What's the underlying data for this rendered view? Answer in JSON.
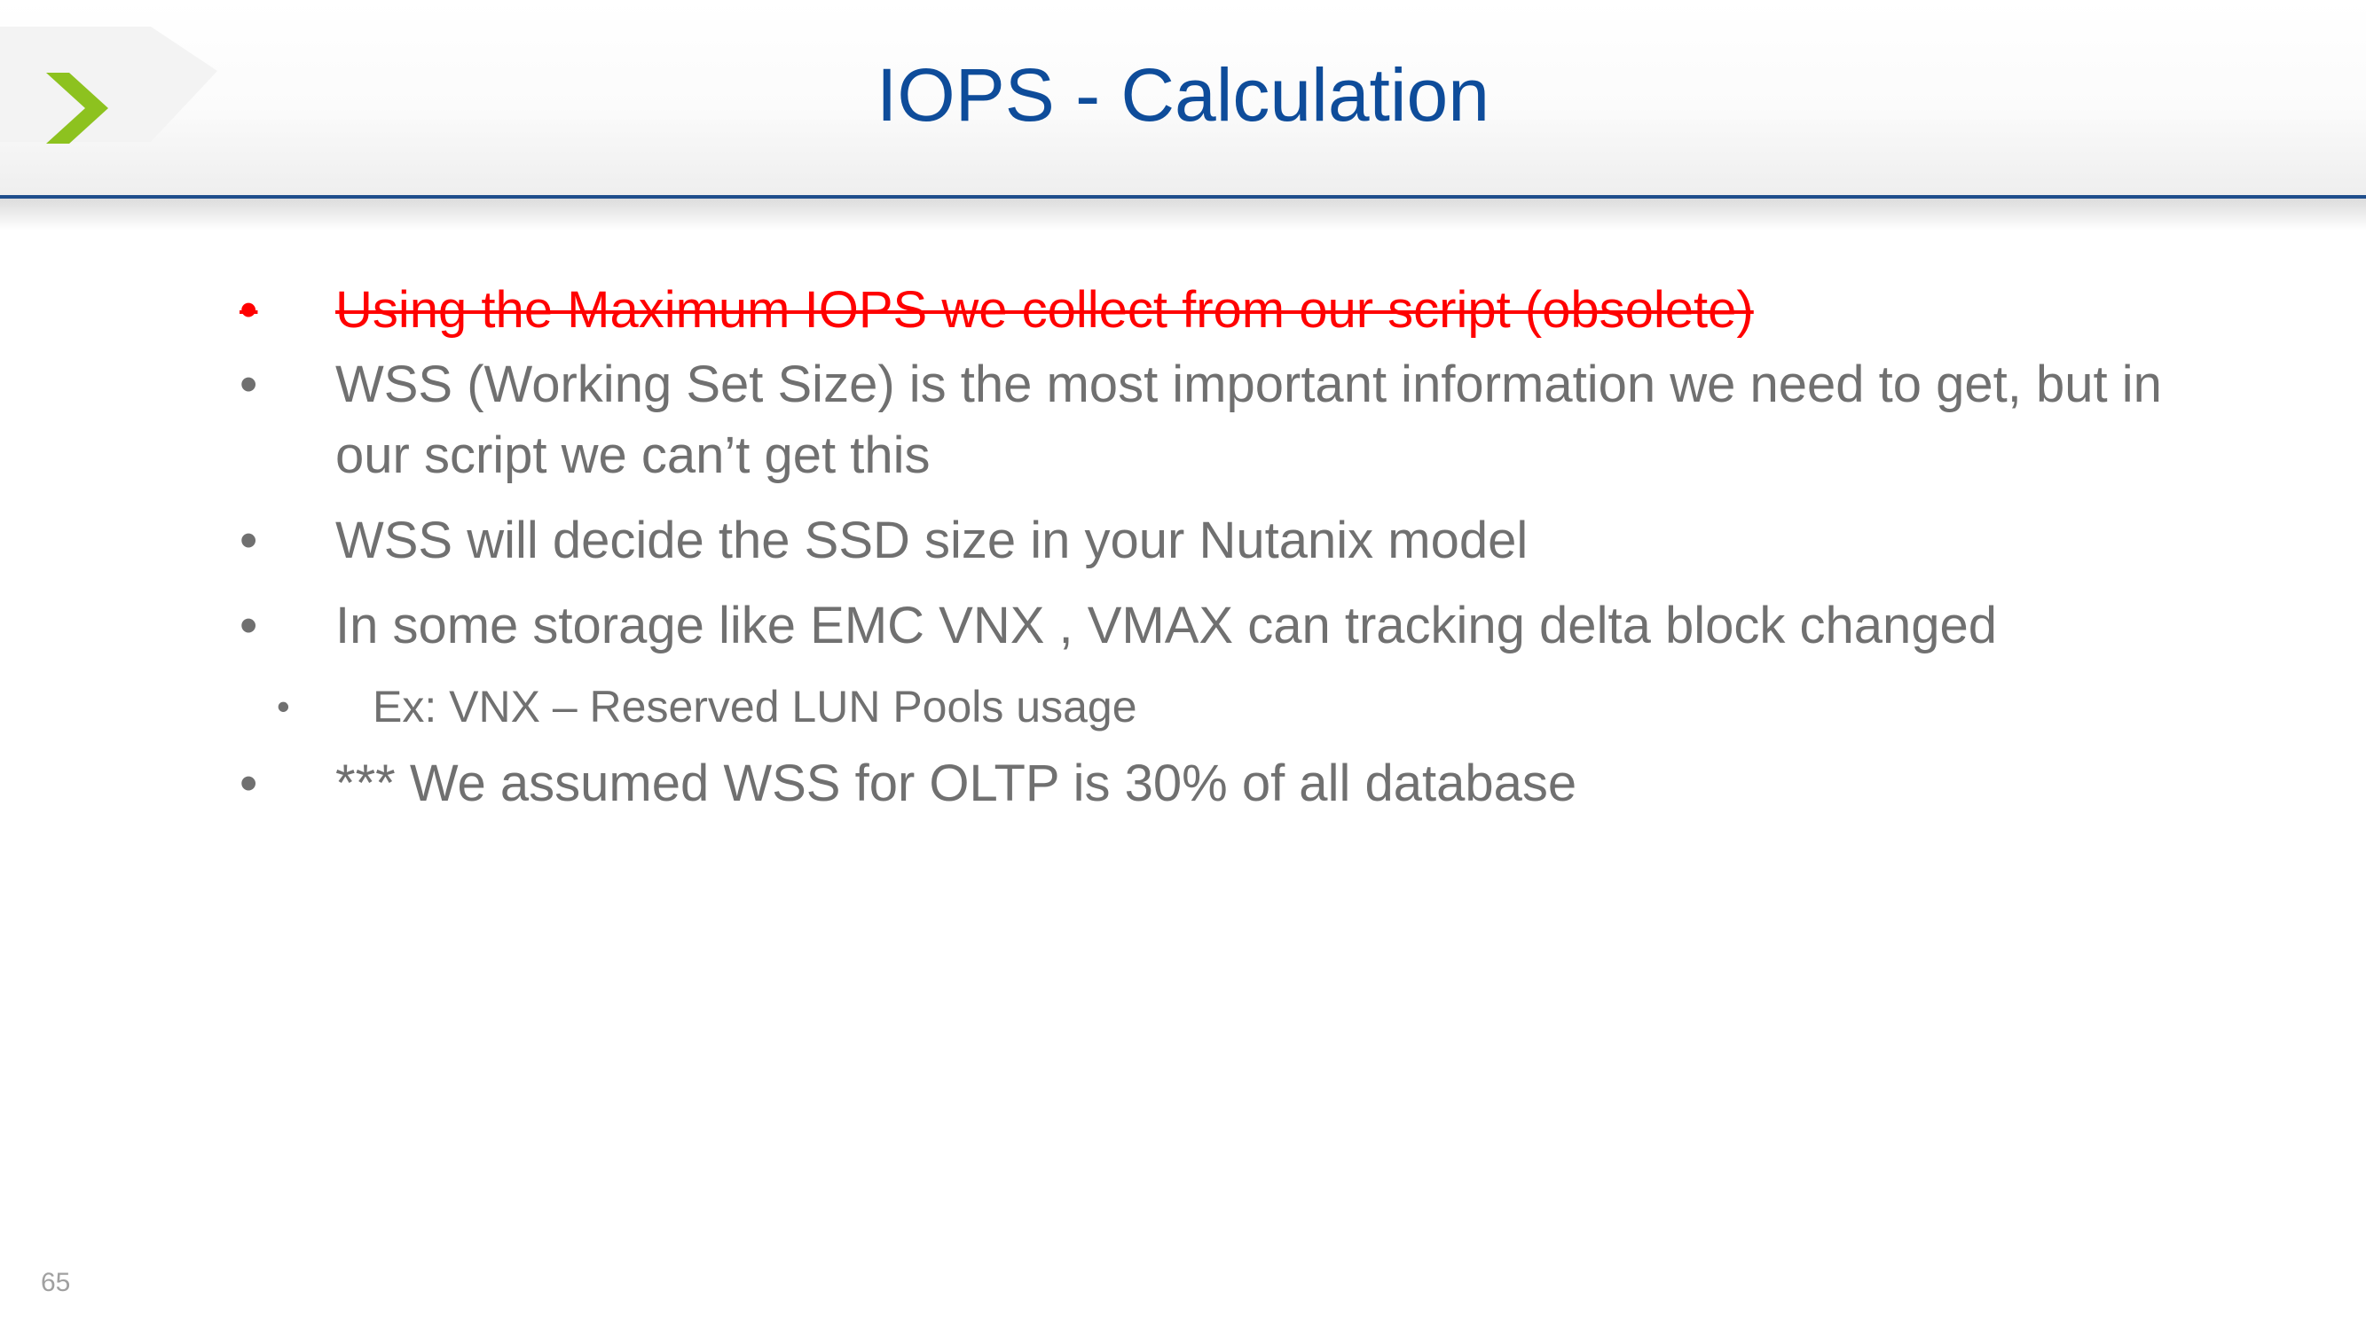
{
  "slide": {
    "title": "IOPS - Calculation",
    "page_number": "65"
  },
  "bullets": [
    {
      "marker": "•",
      "text": "Using the Maximum IOPS we collect from our script (obsolete)",
      "style": "strikethrough",
      "color": "#ff0000"
    },
    {
      "marker": "•",
      "text": "WSS (Working Set Size) is the most important information we need to get, but in our script we can’t get this"
    },
    {
      "marker": "•",
      "text": "WSS will decide the SSD size in your Nutanix model"
    },
    {
      "marker": "•",
      "text": "In some storage like EMC VNX , VMAX can tracking delta block changed"
    },
    {
      "marker": "•",
      "text": "Ex: VNX – Reserved LUN Pools usage",
      "level": 2
    },
    {
      "marker": "•",
      "text": "*** We assumed WSS for OLTP is 30% of all database"
    }
  ],
  "colors": {
    "title": "#0e4c9a",
    "body_text": "#707070",
    "rule": "#1f4e8c",
    "logo_chevron": "#8dc21f",
    "struck_text": "#ff0000"
  },
  "logo": {
    "icon": "chevron-right-icon"
  }
}
